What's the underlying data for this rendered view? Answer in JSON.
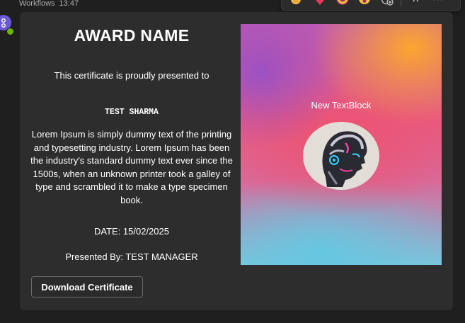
{
  "header": {
    "sender": "Workflows",
    "time": "13:47"
  },
  "reactions": {
    "items": [
      "like-icon",
      "heart-icon",
      "laugh-icon",
      "surprised-icon",
      "add-reaction-icon",
      "reply-icon",
      "more-options-icon"
    ]
  },
  "certificate": {
    "title": "AWARD NAME",
    "presented_to": "This certificate is proudly presented to",
    "recipient": "TEST SHARMA",
    "body": "Lorem Ipsum is simply dummy text of the printing and typesetting industry. Lorem Ipsum has been the industry's standard dummy text ever since the 1500s, when an unknown printer took a galley of type and scrambled it to make a type specimen book.",
    "date": "DATE: 15/02/2025",
    "presented_by": "Presented By: TEST MANAGER",
    "download_label": "Download Certificate"
  },
  "image_panel": {
    "label": "New TextBlock"
  },
  "colors": {
    "card_bg": "#2d2d2d",
    "page_bg": "#1f1f1f",
    "avatar": "#6b5ad6",
    "status_online": "#6bb700"
  }
}
